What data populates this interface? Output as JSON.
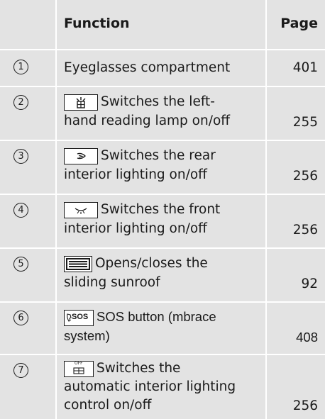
{
  "header": {
    "function": "Function",
    "page": "Page"
  },
  "rows": [
    {
      "num": "1",
      "text": "Eyeglasses compartment",
      "page": "401",
      "icon": ""
    },
    {
      "num": "2",
      "text_line1": "Switches the left-",
      "text_line2": "hand reading lamp on/off",
      "page": "255",
      "icon": "reading-lamp-icon"
    },
    {
      "num": "3",
      "text_line1": "Switches the rear",
      "text_line2": "interior lighting on/off",
      "page": "256",
      "icon": "rear-interior-light-icon"
    },
    {
      "num": "4",
      "text_line1": "Switches the front",
      "text_line2": "interior lighting on/off",
      "page": "256",
      "icon": "front-interior-light-icon"
    },
    {
      "num": "5",
      "text_line1": "Opens/closes the",
      "text_line2": "sliding sunroof",
      "page": "92",
      "icon": "sunroof-icon"
    },
    {
      "num": "6",
      "text_line1": "SOS button (mbrace",
      "text_line2": "system)",
      "page": "408",
      "icon": "sos-icon",
      "icon_label": "SOS"
    },
    {
      "num": "7",
      "text_line1": "Switches the",
      "text_line2": "automatic interior lighting",
      "text_line3": "control on/off",
      "page": "256",
      "icon": "auto-light-off-icon",
      "icon_label": "OFF"
    }
  ]
}
